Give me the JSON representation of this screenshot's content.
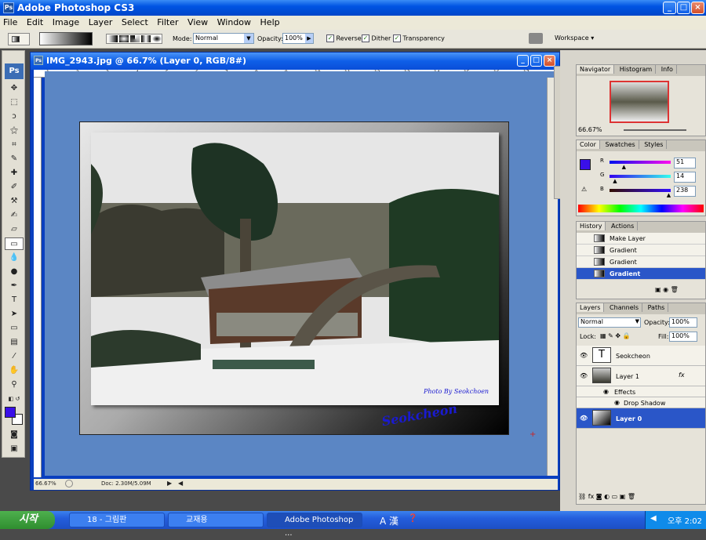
{
  "app": {
    "title": "Adobe Photoshop CS3",
    "ps_logo": "Ps"
  },
  "window_buttons": [
    "_",
    "□",
    "×"
  ],
  "menu": [
    "File",
    "Edit",
    "Image",
    "Layer",
    "Select",
    "Filter",
    "View",
    "Window",
    "Help"
  ],
  "options": {
    "mode_label": "Mode:",
    "mode_value": "Normal",
    "opacity_label": "Opacity:",
    "opacity_value": "100%",
    "reverse": "Reverse",
    "dither": "Dither",
    "transparency": "Transparency",
    "workspace": "Workspace ▾"
  },
  "document": {
    "title": "IMG_2943.jpg @ 66.7% (Layer 0, RGB/8#)",
    "zoom": "66.67%",
    "doc_size": "Doc: 2.30M/5.09M"
  },
  "ruler_ticks": [
    "1",
    "2",
    "3",
    "4",
    "5",
    "6",
    "7",
    "8",
    "9",
    "10",
    "11",
    "12",
    "13",
    "14",
    "15",
    "16",
    "17"
  ],
  "photo": {
    "signature_small": "Photo By Seokchoen",
    "signature_large": "Seokcheon"
  },
  "navigator": {
    "tabs": [
      "Navigator",
      "Histogram",
      "Info"
    ],
    "zoom": "66.67%"
  },
  "color": {
    "tabs": [
      "Color",
      "Swatches",
      "Styles"
    ],
    "r_label": "R",
    "g_label": "G",
    "b_label": "B",
    "r": "51",
    "g": "14",
    "b": "238",
    "r_fill": 0.2,
    "g_fill": 0.055,
    "b_fill": 0.933,
    "fg": "#330ee"
  },
  "history": {
    "tabs": [
      "History",
      "Actions"
    ],
    "items": [
      "Make Layer",
      "Gradient",
      "Gradient",
      "Gradient"
    ],
    "selected": 3
  },
  "layers": {
    "tabs": [
      "Layers",
      "Channels",
      "Paths"
    ],
    "blend": "Normal",
    "opacity_label": "Opacity:",
    "opacity": "100%",
    "lock_label": "Lock:",
    "fill_label": "Fill:",
    "fill": "100%",
    "rows": [
      "Seokcheon",
      "Layer 1",
      "Effects",
      "Drop Shadow",
      "Layer 0"
    ],
    "fx": "fx"
  },
  "taskbar": {
    "start": "시작",
    "tasks": [
      "18 - 그림판",
      "교재용",
      "Adobe Photoshop ..."
    ],
    "time": "오후 2:02",
    "ime": "A 漢"
  },
  "colors": {
    "accent": "#0054e3",
    "doc_bg": "#5b86c4",
    "fg_color": "#3a10e8"
  }
}
